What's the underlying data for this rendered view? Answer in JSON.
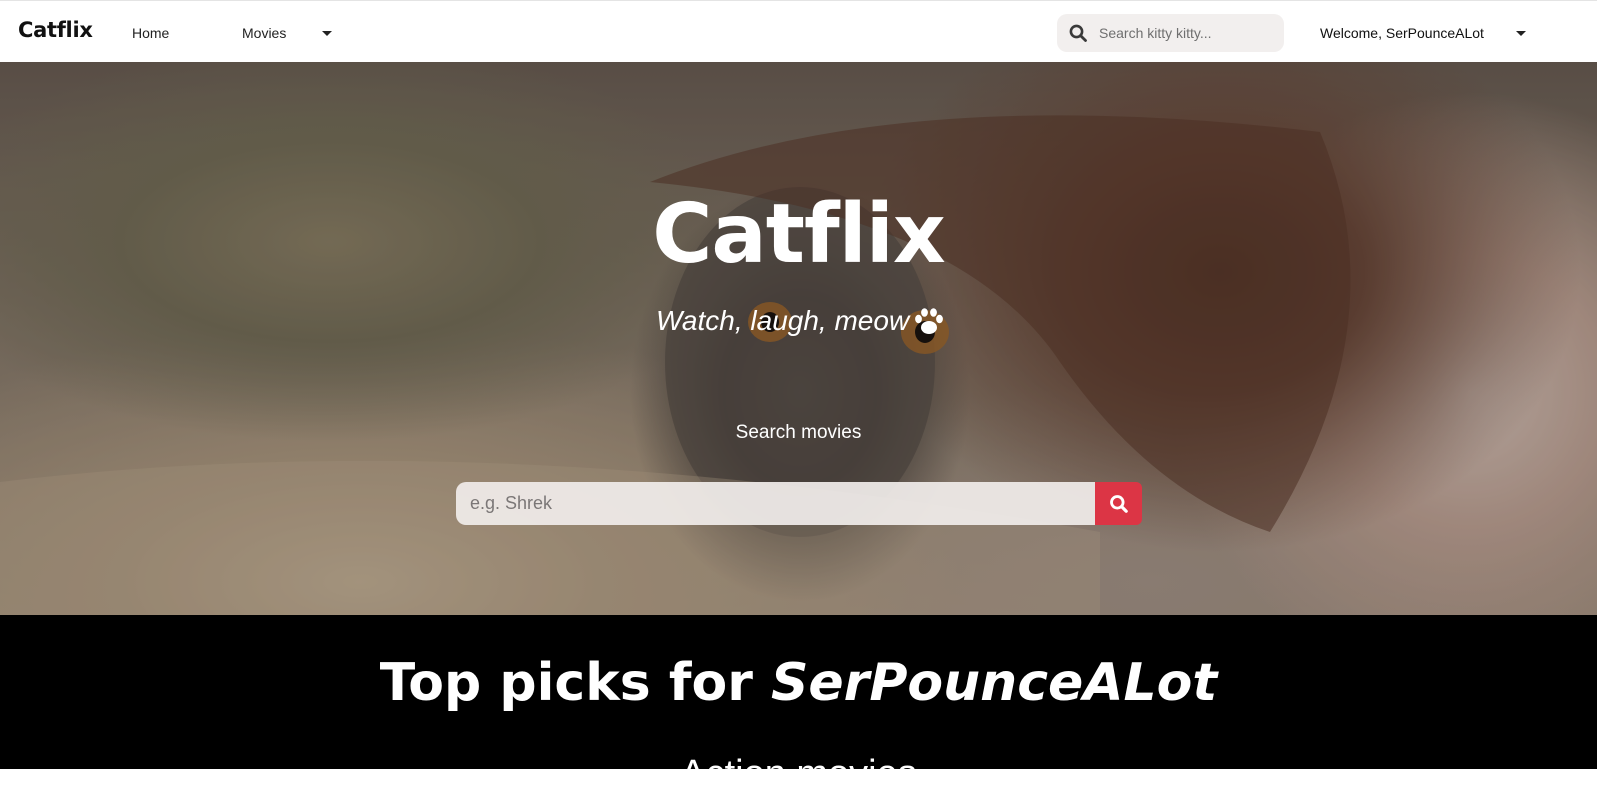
{
  "navbar": {
    "brand": "Catflix",
    "links": [
      {
        "label": "Home"
      },
      {
        "label": "Movies"
      }
    ],
    "search": {
      "placeholder": "Search kitty kitty..."
    },
    "user_menu": {
      "label": "Welcome, SerPounceALot"
    }
  },
  "hero": {
    "title": "Catflix",
    "tagline": "Watch, laugh, meow",
    "search_label": "Search movies",
    "search_placeholder": "e.g. Shrek",
    "icons": {
      "tagline": "paw-icon",
      "search_button": "search-icon"
    }
  },
  "section": {
    "title_prefix": "Top picks for ",
    "title_user": "SerPounceALot",
    "subtitle": "Action movies"
  },
  "colors": {
    "accent": "#dc3545",
    "section_background": "#000000",
    "navbar_background": "#ffffff"
  }
}
